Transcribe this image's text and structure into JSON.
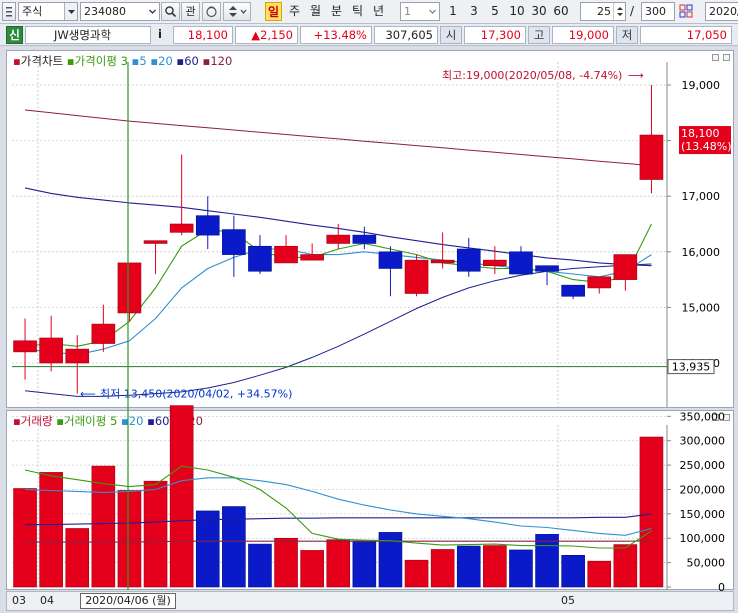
{
  "toolbar": {
    "market_type": "주식",
    "stock_code": "234080",
    "watchlist_label": "관",
    "periods": [
      "일",
      "주",
      "월",
      "분",
      "틱",
      "년"
    ],
    "selected_period": "일",
    "interval_value": "1",
    "interval_buttons": [
      "1",
      "3",
      "5",
      "10",
      "30",
      "60"
    ],
    "visible_count": "25",
    "separator": "/",
    "total_count": "300",
    "date": "2020/"
  },
  "info": {
    "credit_badge": "신",
    "stock_name": "JW생명과학",
    "info_badge": "i",
    "price": "18,100",
    "change": "▲2,150",
    "change_pct": "+13.48%",
    "volume": "307,605",
    "open_label": "시",
    "open": "17,300",
    "high_label": "고",
    "high": "19,000",
    "low_label": "저",
    "low": "17,050"
  },
  "price_panel": {
    "legend_title": "가격차트",
    "ma_title": "가격이평",
    "ma_periods": [
      "3",
      "5",
      "20",
      "60",
      "120"
    ],
    "y_ticks": [
      "19,000",
      "18,000",
      "17,000",
      "16,000",
      "15,000",
      "14,000"
    ],
    "high_annotation": "최고:19,000(2020/05/08, -4.74%)",
    "high_arrow": "⟶",
    "low_annotation": "최저 13,450(2020/04/02, +34.57%)",
    "low_arrow": "⟵",
    "current_price_label": "18,100",
    "current_pct_label": "(13.48%)",
    "hline_label": "13,935"
  },
  "volume_panel": {
    "legend_title": "거래량",
    "ma_title": "거래이평",
    "ma_periods": [
      "5",
      "20",
      "60",
      "120"
    ],
    "y_ticks": [
      "350,000",
      "300,000",
      "250,000",
      "200,000",
      "150,000",
      "100,000",
      "50,000",
      "0"
    ]
  },
  "xaxis": {
    "labels": [
      "03",
      "04",
      "05"
    ],
    "crosshair_date": "2020/04/06 (월)"
  },
  "colors": {
    "up": "#e4001b",
    "down": "#0a1ac8",
    "ma3": "#3a9a10",
    "ma5": "#3090d0",
    "ma20": "#202090",
    "ma60": "#202090",
    "ma120": "#8a2040",
    "crosshair": "#2a9a2a"
  },
  "chart_data": {
    "type": "candlestick",
    "title": "JW생명과학",
    "ylim": [
      13800,
      19300
    ],
    "candles": [
      {
        "open": 14200,
        "high": 14800,
        "low": 13700,
        "close": 14400
      },
      {
        "open": 14000,
        "high": 14850,
        "low": 13850,
        "close": 14450
      },
      {
        "open": 14000,
        "high": 14500,
        "low": 13450,
        "close": 14250
      },
      {
        "open": 14350,
        "high": 15050,
        "low": 14200,
        "close": 14700
      },
      {
        "open": 14900,
        "high": 15800,
        "low": 14750,
        "close": 15800
      },
      {
        "open": 16150,
        "high": 16200,
        "low": 15600,
        "close": 16200
      },
      {
        "open": 16350,
        "high": 17750,
        "low": 16300,
        "close": 16500
      },
      {
        "open": 16650,
        "high": 17000,
        "low": 16050,
        "close": 16300
      },
      {
        "open": 16400,
        "high": 16650,
        "low": 15550,
        "close": 15950
      },
      {
        "open": 16100,
        "high": 16300,
        "low": 15600,
        "close": 15650
      },
      {
        "open": 15800,
        "high": 16300,
        "low": 15800,
        "close": 16100
      },
      {
        "open": 15850,
        "high": 16150,
        "low": 15850,
        "close": 15950
      },
      {
        "open": 16150,
        "high": 16500,
        "low": 16050,
        "close": 16300
      },
      {
        "open": 16300,
        "high": 16450,
        "low": 16050,
        "close": 16150
      },
      {
        "open": 16000,
        "high": 16100,
        "low": 15200,
        "close": 15700
      },
      {
        "open": 15250,
        "high": 15950,
        "low": 15200,
        "close": 15850
      },
      {
        "open": 15800,
        "high": 16350,
        "low": 15700,
        "close": 15850
      },
      {
        "open": 16050,
        "high": 16250,
        "low": 15550,
        "close": 15650
      },
      {
        "open": 15750,
        "high": 16100,
        "low": 15600,
        "close": 15850
      },
      {
        "open": 16000,
        "high": 16100,
        "low": 15600,
        "close": 15600
      },
      {
        "open": 15750,
        "high": 15750,
        "low": 15400,
        "close": 15650
      },
      {
        "open": 15400,
        "high": 15400,
        "low": 15150,
        "close": 15200
      },
      {
        "open": 15350,
        "high": 15550,
        "low": 15250,
        "close": 15550
      },
      {
        "open": 15500,
        "high": 15950,
        "low": 15300,
        "close": 15950
      },
      {
        "open": 17300,
        "high": 19000,
        "low": 17050,
        "close": 18100
      }
    ],
    "volumes": [
      202000,
      235000,
      120000,
      248000,
      198000,
      217000,
      372000,
      156000,
      165000,
      88000,
      100000,
      75000,
      97000,
      94000,
      112000,
      55000,
      77000,
      84000,
      85000,
      76000,
      108000,
      65000,
      53000,
      87000,
      307605
    ],
    "ma_price": {
      "ma3": [
        14300,
        14350,
        14300,
        14400,
        14750,
        15350,
        16100,
        16400,
        16350,
        16000,
        15900,
        15900,
        16050,
        16150,
        16050,
        15950,
        15800,
        15750,
        15700,
        15700,
        15650,
        15500,
        15450,
        15550,
        16500
      ],
      "ma5": [
        14250,
        14200,
        14150,
        14250,
        14400,
        14800,
        15350,
        15700,
        15900,
        16050,
        16050,
        15950,
        15950,
        16000,
        15950,
        15900,
        15850,
        15800,
        15750,
        15700,
        15650,
        15600,
        15550,
        15650,
        15950
      ],
      "ma20": [
        17150,
        17050,
        16980,
        16930,
        16880,
        16840,
        16800,
        16740,
        16680,
        16620,
        16550,
        16480,
        16420,
        16350,
        16270,
        16200,
        16130,
        16070,
        16010,
        15950,
        15890,
        15850,
        15800,
        15770,
        15750
      ],
      "ma60": [
        13500,
        13450,
        13400,
        13400,
        13420,
        13450,
        13480,
        13550,
        13650,
        13780,
        13920,
        14100,
        14300,
        14520,
        14750,
        14980,
        15180,
        15350,
        15480,
        15580,
        15650,
        15700,
        15730,
        15760,
        15780
      ],
      "ma120": [
        18550,
        18500,
        18450,
        18400,
        18350,
        18310,
        18270,
        18230,
        18190,
        18150,
        18110,
        18070,
        18030,
        17990,
        17950,
        17910,
        17870,
        17830,
        17790,
        17750,
        17710,
        17670,
        17630,
        17590,
        17550
      ]
    },
    "ma_volume": {
      "ma5": [
        240000,
        228000,
        220000,
        212000,
        206000,
        210000,
        248000,
        240000,
        225000,
        200000,
        162000,
        110000,
        98000,
        96000,
        95000,
        90000,
        86000,
        87000,
        88000,
        85000,
        85000,
        84000,
        80000,
        80000,
        115000
      ],
      "ma20": [
        200000,
        198000,
        196000,
        194000,
        196000,
        200000,
        218000,
        224000,
        224000,
        218000,
        210000,
        196000,
        180000,
        168000,
        158000,
        150000,
        145000,
        140000,
        133000,
        125000,
        122000,
        116000,
        110000,
        106000,
        120000
      ],
      "ma60": [
        128000,
        128000,
        129000,
        130000,
        131000,
        133000,
        136000,
        138000,
        139000,
        140000,
        141000,
        141000,
        142000,
        142000,
        142000,
        142000,
        142000,
        142000,
        142000,
        142000,
        142000,
        142000,
        143000,
        143000,
        150000
      ],
      "ma120": [
        92000,
        92000,
        92000,
        92000,
        92000,
        93000,
        94000,
        94000,
        94000,
        94000,
        94000,
        94000,
        94000,
        94000,
        94000,
        94000,
        94000,
        94000,
        94000,
        94000,
        94000,
        94000,
        94000,
        94000,
        95000
      ]
    },
    "hline": 13935
  }
}
